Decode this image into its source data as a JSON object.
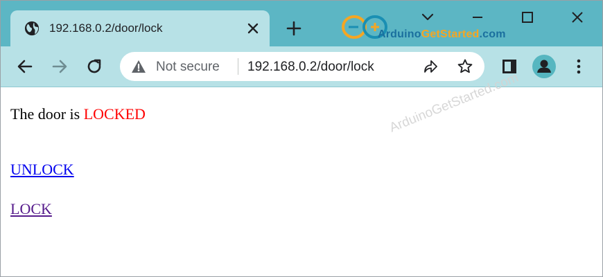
{
  "tab": {
    "title": "192.168.0.2/door/lock"
  },
  "logo": {
    "part1": "Arduino",
    "part2": "GetStarted",
    "part3": ".com"
  },
  "omnibox": {
    "security_label": "Not secure",
    "url": "192.168.0.2/door/lock"
  },
  "page": {
    "status_prefix": "The door is ",
    "status_value": "LOCKED",
    "unlock_link": "UNLOCK",
    "lock_link": "LOCK"
  },
  "watermark": "ArduinoGetStarted.com",
  "colors": {
    "tabstrip": "#5cb6c4",
    "toolbar": "#b7e1e6",
    "status_value": "#ff0000",
    "link": "#0000ee",
    "visited_link": "#551a8b",
    "logo_blue": "#1a6f9e",
    "logo_orange": "#f5a623"
  },
  "icons": [
    "globe-icon",
    "close-icon",
    "plus-icon",
    "chevron-down-icon",
    "minimize-icon",
    "maximize-icon",
    "window-close-icon",
    "back-icon",
    "forward-icon",
    "reload-icon",
    "warning-icon",
    "share-icon",
    "star-icon",
    "side-panel-icon",
    "profile-icon",
    "more-vert-icon"
  ]
}
